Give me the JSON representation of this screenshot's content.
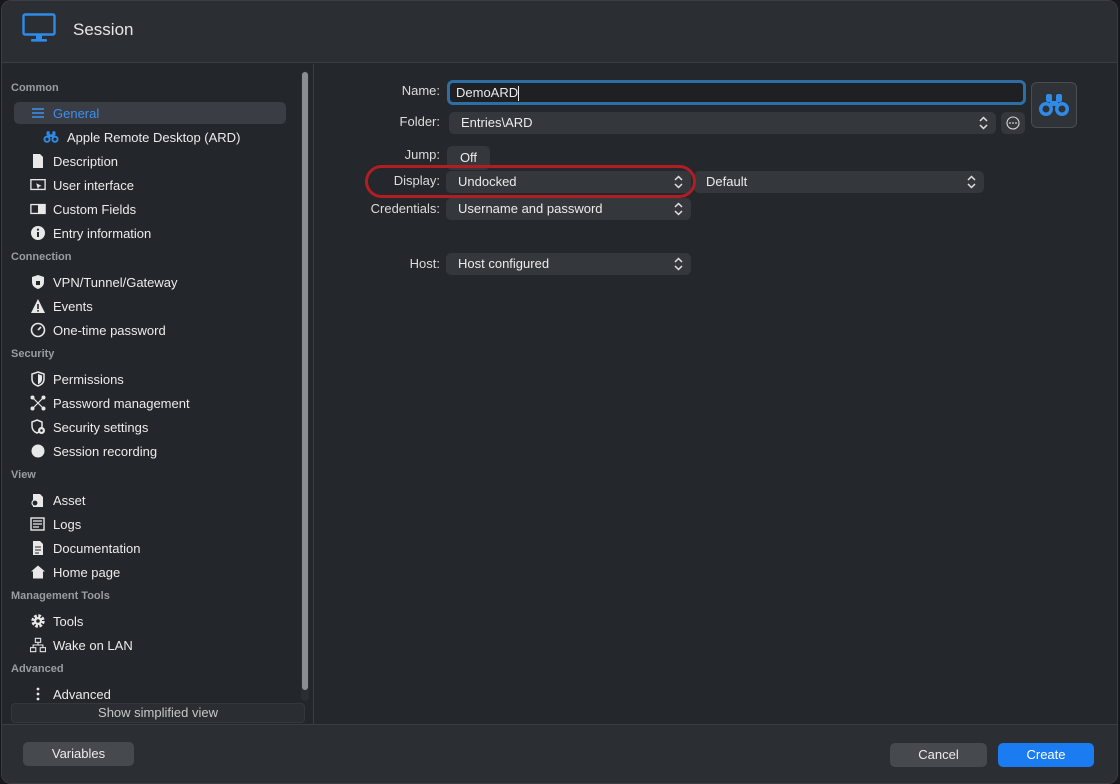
{
  "window": {
    "title": "Session",
    "app_icon": "monitor-icon"
  },
  "sidebar": {
    "sections": [
      {
        "title": "Common",
        "items": [
          {
            "label": "General",
            "icon": "list-lines-icon",
            "active": true
          },
          {
            "label": "Apple Remote Desktop (ARD)",
            "icon": "binoculars-icon",
            "sub": true
          },
          {
            "label": "Description",
            "icon": "document-icon"
          },
          {
            "label": "User interface",
            "icon": "window-cursor-icon"
          },
          {
            "label": "Custom Fields",
            "icon": "custom-fields-icon"
          },
          {
            "label": "Entry information",
            "icon": "info-icon"
          }
        ]
      },
      {
        "title": "Connection",
        "items": [
          {
            "label": "VPN/Tunnel/Gateway",
            "icon": "shield-lock-icon"
          },
          {
            "label": "Events",
            "icon": "warning-icon"
          },
          {
            "label": "One-time password",
            "icon": "timer-icon"
          }
        ]
      },
      {
        "title": "Security",
        "items": [
          {
            "label": "Permissions",
            "icon": "shield-icon"
          },
          {
            "label": "Password management",
            "icon": "network-nodes-icon"
          },
          {
            "label": "Security settings",
            "icon": "shield-gear-icon"
          },
          {
            "label": "Session recording",
            "icon": "record-circle-icon"
          }
        ]
      },
      {
        "title": "View",
        "items": [
          {
            "label": "Asset",
            "icon": "asset-icon"
          },
          {
            "label": "Logs",
            "icon": "logs-icon"
          },
          {
            "label": "Documentation",
            "icon": "documentation-icon"
          },
          {
            "label": "Home page",
            "icon": "home-icon"
          }
        ]
      },
      {
        "title": "Management Tools",
        "items": [
          {
            "label": "Tools",
            "icon": "gear-icon"
          },
          {
            "label": "Wake on LAN",
            "icon": "lan-network-icon"
          }
        ]
      },
      {
        "title": "Advanced",
        "items": [
          {
            "label": "Advanced",
            "icon": "more-vertical-icon"
          }
        ]
      }
    ],
    "simplified_view_label": "Show simplified view"
  },
  "form": {
    "name_label": "Name:",
    "name_value": "DemoARD",
    "folder_label": "Folder:",
    "folder_value": "Entries\\ARD",
    "jump_label": "Jump:",
    "jump_value": "Off",
    "display_label": "Display:",
    "display_value": "Undocked",
    "display_option_value": "Default",
    "credentials_label": "Credentials:",
    "credentials_value": "Username and password",
    "host_label": "Host:",
    "host_value": "Host configured"
  },
  "footer": {
    "variables_label": "Variables",
    "cancel_label": "Cancel",
    "create_label": "Create"
  },
  "colors": {
    "accent": "#1a7cf0",
    "highlight_ring": "#b01e24",
    "active_text": "#3d8ff0"
  }
}
